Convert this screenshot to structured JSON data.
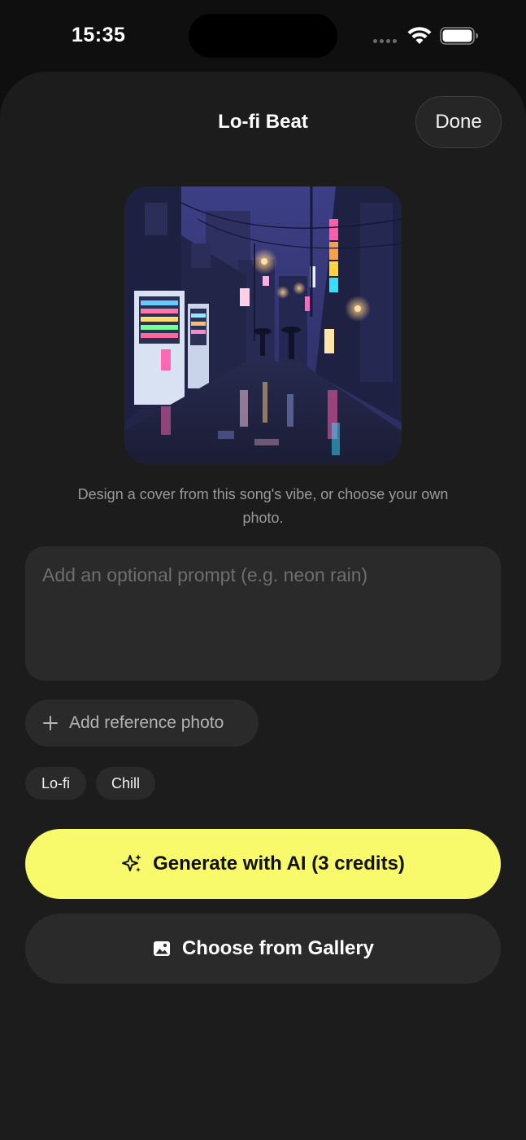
{
  "status_bar": {
    "time": "15:35",
    "signal_icon": "cellular-signal-icon",
    "wifi_icon": "wifi-icon",
    "battery_icon": "battery-icon"
  },
  "sheet": {
    "title": "Lo-fi Beat",
    "done_label": "Done"
  },
  "cover": {
    "image_icon": "rainy-neon-alley-artwork"
  },
  "caption": "Design a cover from this song's vibe, or choose your own photo.",
  "prompt": {
    "placeholder": "Add an optional prompt (e.g. neon rain)",
    "value": ""
  },
  "reference": {
    "label": "Add reference photo",
    "icon": "plus-icon"
  },
  "tags": [
    "Lo-fi",
    "Chill"
  ],
  "actions": {
    "generate_label": "Generate with AI (3 credits)",
    "generate_icon": "sparkle-icon",
    "gallery_label": "Choose from Gallery",
    "gallery_icon": "photo-icon"
  },
  "colors": {
    "accent": "#f8fa6c",
    "background": "#1c1c1c",
    "surface": "#2a2a2b"
  }
}
